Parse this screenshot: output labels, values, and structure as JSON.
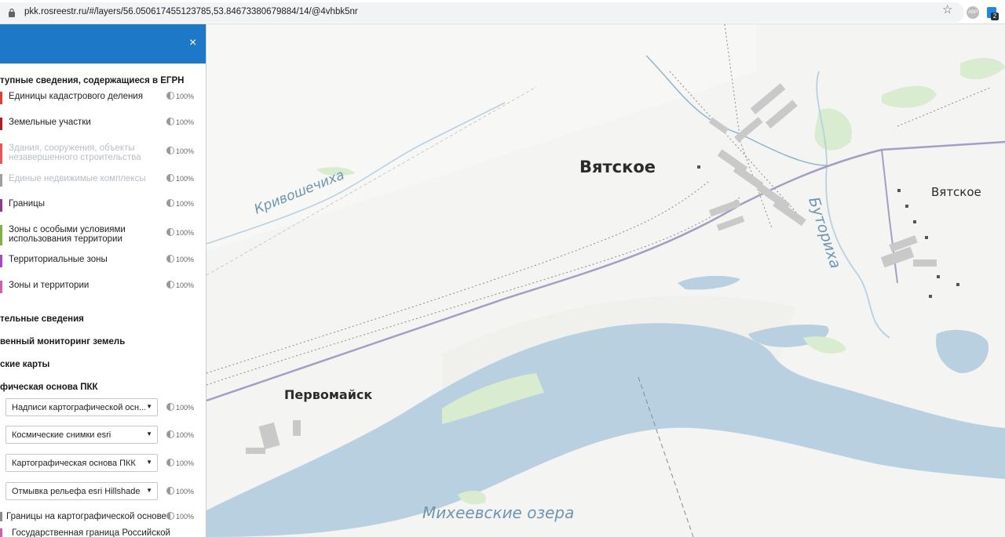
{
  "browser": {
    "url": "pkk.rosreestr.ru/#/layers/56.050617455123785,53.84673380679884/14/@4vhbk5nr",
    "star_icon": "star-icon",
    "ext1_label": "ABP",
    "ext2_badge": "2"
  },
  "sidebar": {
    "close_symbol": "×",
    "collapse_symbol": "‹",
    "egrn_title": "тупные сведения, содержащиеся в ЕГРН",
    "layers": [
      {
        "label": "Единицы кадастрового деления",
        "opacity": "100%",
        "color": "#e53935",
        "enabled": true
      },
      {
        "label": "Земельные участки",
        "opacity": "100%",
        "color": "#b71c1c",
        "enabled": true
      },
      {
        "label": "Здания, сооружения, объекты незавершенного строительства",
        "opacity": "100%",
        "color": "#ef5350",
        "enabled": false
      },
      {
        "label": "Единые недвижимые комплексы",
        "opacity": "100%",
        "color": "#9e9e9e",
        "enabled": false
      },
      {
        "label": "Границы",
        "opacity": "100%",
        "color": "#8e3a8e",
        "enabled": true
      },
      {
        "label": "Зоны с особыми условиями использования территории",
        "opacity": "100%",
        "color": "#7cb342",
        "enabled": true
      },
      {
        "label": "Территориальные зоны",
        "opacity": "100%",
        "color": "#ab47bc",
        "enabled": true
      },
      {
        "label": "Зоны и территории",
        "opacity": "100%",
        "color": "#ce5fb0",
        "enabled": true
      }
    ],
    "sections": [
      "тельные сведения",
      "венный мониторинг земель",
      "ские карты",
      "фическая основа ПКК"
    ],
    "basemaps": [
      {
        "label": "Надписи картографической осн...",
        "opacity": "100%"
      },
      {
        "label": "Космические снимки esri",
        "opacity": "100%"
      },
      {
        "label": "Картографическая основа ПКК",
        "opacity": "100%"
      },
      {
        "label": "Отмывка рельефа esri Hillshade",
        "opacity": "100%"
      }
    ],
    "bottom_layers": [
      {
        "label": "Границы на картографической основе",
        "opacity": "100%"
      },
      {
        "label": "Государственная граница Российской",
        "opacity": ""
      }
    ],
    "caret": "▼"
  },
  "map": {
    "places": [
      "Вятское",
      "Вятское",
      "Первомайск"
    ],
    "water": [
      "Кривошечиха",
      "Буториха",
      "Михеевские озера"
    ],
    "colors": {
      "water": "#b8d0df",
      "green": "#d9ecd0",
      "road": "#a39ec4",
      "rail": "#8a8a8a",
      "land": "#f4f4f2"
    }
  }
}
